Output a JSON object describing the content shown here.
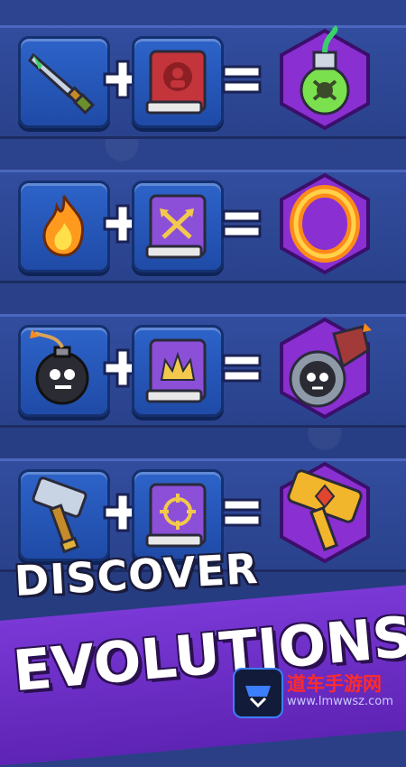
{
  "recipes": [
    {
      "input_1": "dagger-icon",
      "input_2": "red-book-icon",
      "result": "poison-potion-icon"
    },
    {
      "input_1": "fire-icon",
      "input_2": "purple-book-arrows-icon",
      "result": "fire-ring-icon"
    },
    {
      "input_1": "bomb-icon",
      "input_2": "purple-book-crown-icon",
      "result": "skull-cannon-icon"
    },
    {
      "input_1": "hammer-icon",
      "input_2": "purple-book-target-icon",
      "result": "golden-hammer-icon"
    }
  ],
  "operators": {
    "plus": "+",
    "equals": "="
  },
  "banner": {
    "line_1": "DISCOVER",
    "line_2": "EVOLUTIONS"
  },
  "watermark": {
    "name": "道车手游网",
    "url": "www.lmwwsz.com"
  },
  "colors": {
    "slot_blue": "#2d63c9",
    "result_purple": "#8a2fd1",
    "banner_purple": "#6b2cc4",
    "plus_white": "#ffffff"
  }
}
